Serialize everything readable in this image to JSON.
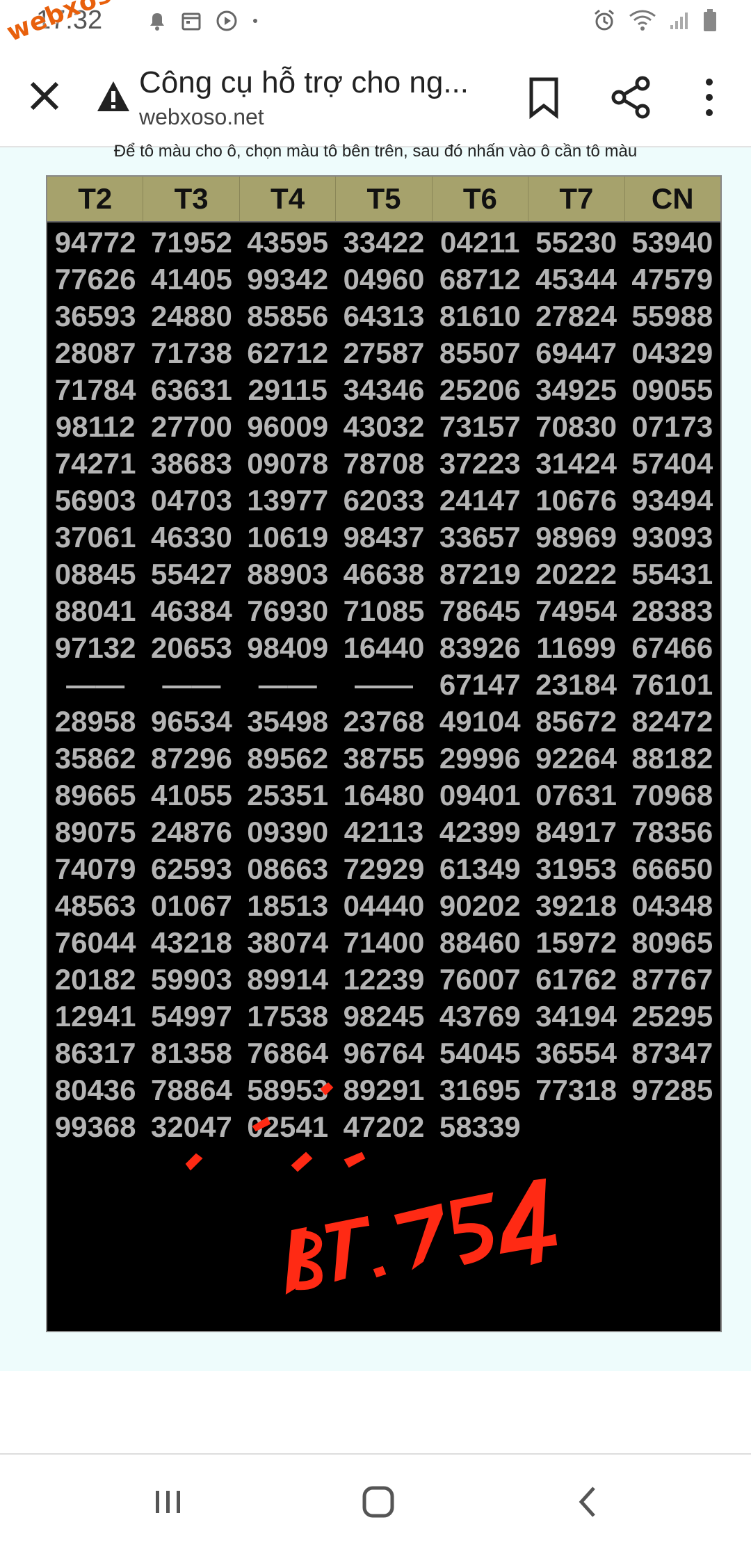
{
  "status": {
    "time": "17:32"
  },
  "watermark": "webxoso.net",
  "appbar": {
    "title": "Công cụ hỗ trợ cho ng...",
    "url": "webxoso.net"
  },
  "hint": "Để tô màu cho ô, chọn màu tô bên trên, sau đó nhấn vào ô cần tô màu",
  "board": {
    "headers": [
      "T2",
      "T3",
      "T4",
      "T5",
      "T6",
      "T7",
      "CN"
    ],
    "rows": [
      [
        "94772",
        "71952",
        "43595",
        "33422",
        "04211",
        "55230",
        "53940"
      ],
      [
        "77626",
        "41405",
        "99342",
        "04960",
        "68712",
        "45344",
        "47579"
      ],
      [
        "36593",
        "24880",
        "85856",
        "64313",
        "81610",
        "27824",
        "55988"
      ],
      [
        "28087",
        "71738",
        "62712",
        "27587",
        "85507",
        "69447",
        "04329"
      ],
      [
        "71784",
        "63631",
        "29115",
        "34346",
        "25206",
        "34925",
        "09055"
      ],
      [
        "98112",
        "27700",
        "96009",
        "43032",
        "73157",
        "70830",
        "07173"
      ],
      [
        "74271",
        "38683",
        "09078",
        "78708",
        "37223",
        "31424",
        "57404"
      ],
      [
        "56903",
        "04703",
        "13977",
        "62033",
        "24147",
        "10676",
        "93494"
      ],
      [
        "37061",
        "46330",
        "10619",
        "98437",
        "33657",
        "98969",
        "93093"
      ],
      [
        "08845",
        "55427",
        "88903",
        "46638",
        "87219",
        "20222",
        "55431"
      ],
      [
        "88041",
        "46384",
        "76930",
        "71085",
        "78645",
        "74954",
        "28383"
      ],
      [
        "97132",
        "20653",
        "98409",
        "16440",
        "83926",
        "11699",
        "67466"
      ],
      [
        "——",
        "——",
        "——",
        "——",
        "67147",
        "23184",
        "76101"
      ],
      [
        "28958",
        "96534",
        "35498",
        "23768",
        "49104",
        "85672",
        "82472"
      ],
      [
        "35862",
        "87296",
        "89562",
        "38755",
        "29996",
        "92264",
        "88182"
      ],
      [
        "89665",
        "41055",
        "25351",
        "16480",
        "09401",
        "07631",
        "70968"
      ],
      [
        "89075",
        "24876",
        "09390",
        "42113",
        "42399",
        "84917",
        "78356"
      ],
      [
        "74079",
        "62593",
        "08663",
        "72929",
        "61349",
        "31953",
        "66650"
      ],
      [
        "48563",
        "01067",
        "18513",
        "04440",
        "90202",
        "39218",
        "04348"
      ],
      [
        "76044",
        "43218",
        "38074",
        "71400",
        "88460",
        "15972",
        "80965"
      ],
      [
        "20182",
        "59903",
        "89914",
        "12239",
        "76007",
        "61762",
        "87767"
      ],
      [
        "12941",
        "54997",
        "17538",
        "98245",
        "43769",
        "34194",
        "25295"
      ],
      [
        "86317",
        "81358",
        "76864",
        "96764",
        "54045",
        "36554",
        "87347"
      ],
      [
        "80436",
        "78864",
        "58953",
        "89291",
        "31695",
        "77318",
        "97285"
      ],
      [
        "99368",
        "32047",
        "02541",
        "47202",
        "58339",
        "",
        ""
      ]
    ]
  },
  "annotation": {
    "text": "BT.754",
    "color": "#ff2a14"
  }
}
